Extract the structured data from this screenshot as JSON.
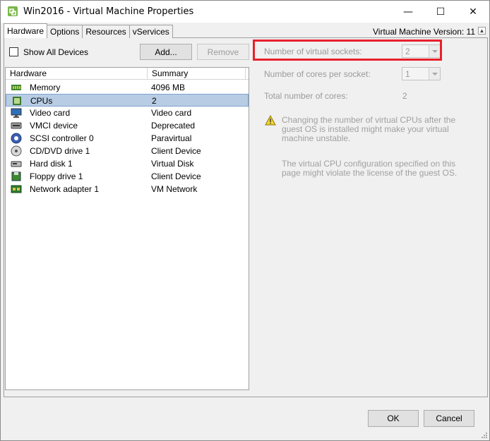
{
  "window": {
    "title": "Win2016 - Virtual Machine Properties",
    "controls": {
      "minimize": "—",
      "maximize": "☐",
      "close": "✕"
    }
  },
  "tabs": [
    {
      "label": "Hardware",
      "active": true
    },
    {
      "label": "Options",
      "active": false
    },
    {
      "label": "Resources",
      "active": false
    },
    {
      "label": "vServices",
      "active": false
    }
  ],
  "vm_version": "Virtual Machine Version: 11",
  "left": {
    "show_all_devices": {
      "label": "Show All Devices",
      "checked": false
    },
    "add_label": "Add...",
    "remove_label": "Remove",
    "columns": [
      "Hardware",
      "Summary"
    ],
    "devices": [
      {
        "name": "Memory",
        "summary": "4096 MB",
        "icon": "memory-icon"
      },
      {
        "name": "CPUs",
        "summary": "2",
        "icon": "cpu-icon",
        "selected": true
      },
      {
        "name": "Video card",
        "summary": "Video card",
        "icon": "video-card-icon"
      },
      {
        "name": "VMCI device",
        "summary": "Deprecated",
        "icon": "vmci-device-icon"
      },
      {
        "name": "SCSI controller 0",
        "summary": "Paravirtual",
        "icon": "scsi-controller-icon"
      },
      {
        "name": "CD/DVD drive 1",
        "summary": "Client Device",
        "icon": "cd-dvd-icon"
      },
      {
        "name": "Hard disk 1",
        "summary": "Virtual Disk",
        "icon": "hard-disk-icon"
      },
      {
        "name": "Floppy drive 1",
        "summary": "Client Device",
        "icon": "floppy-icon"
      },
      {
        "name": "Network adapter 1",
        "summary": "VM Network",
        "icon": "network-adapter-icon"
      }
    ]
  },
  "right": {
    "sockets_label": "Number of virtual sockets:",
    "sockets_value": "2",
    "cores_label": "Number of cores per socket:",
    "cores_value": "1",
    "total_label": "Total number of cores:",
    "total_value": "2",
    "warning": "Changing the number of virtual CPUs after the guest OS is installed might make your virtual machine unstable.",
    "license_note": "The virtual CPU configuration specified on this page might violate the license of the guest OS."
  },
  "footer": {
    "ok_label": "OK",
    "cancel_label": "Cancel"
  },
  "colors": {
    "highlight": "#e8202a",
    "selection": "#b8cce4",
    "disabled_text": "#9a9a9a"
  }
}
